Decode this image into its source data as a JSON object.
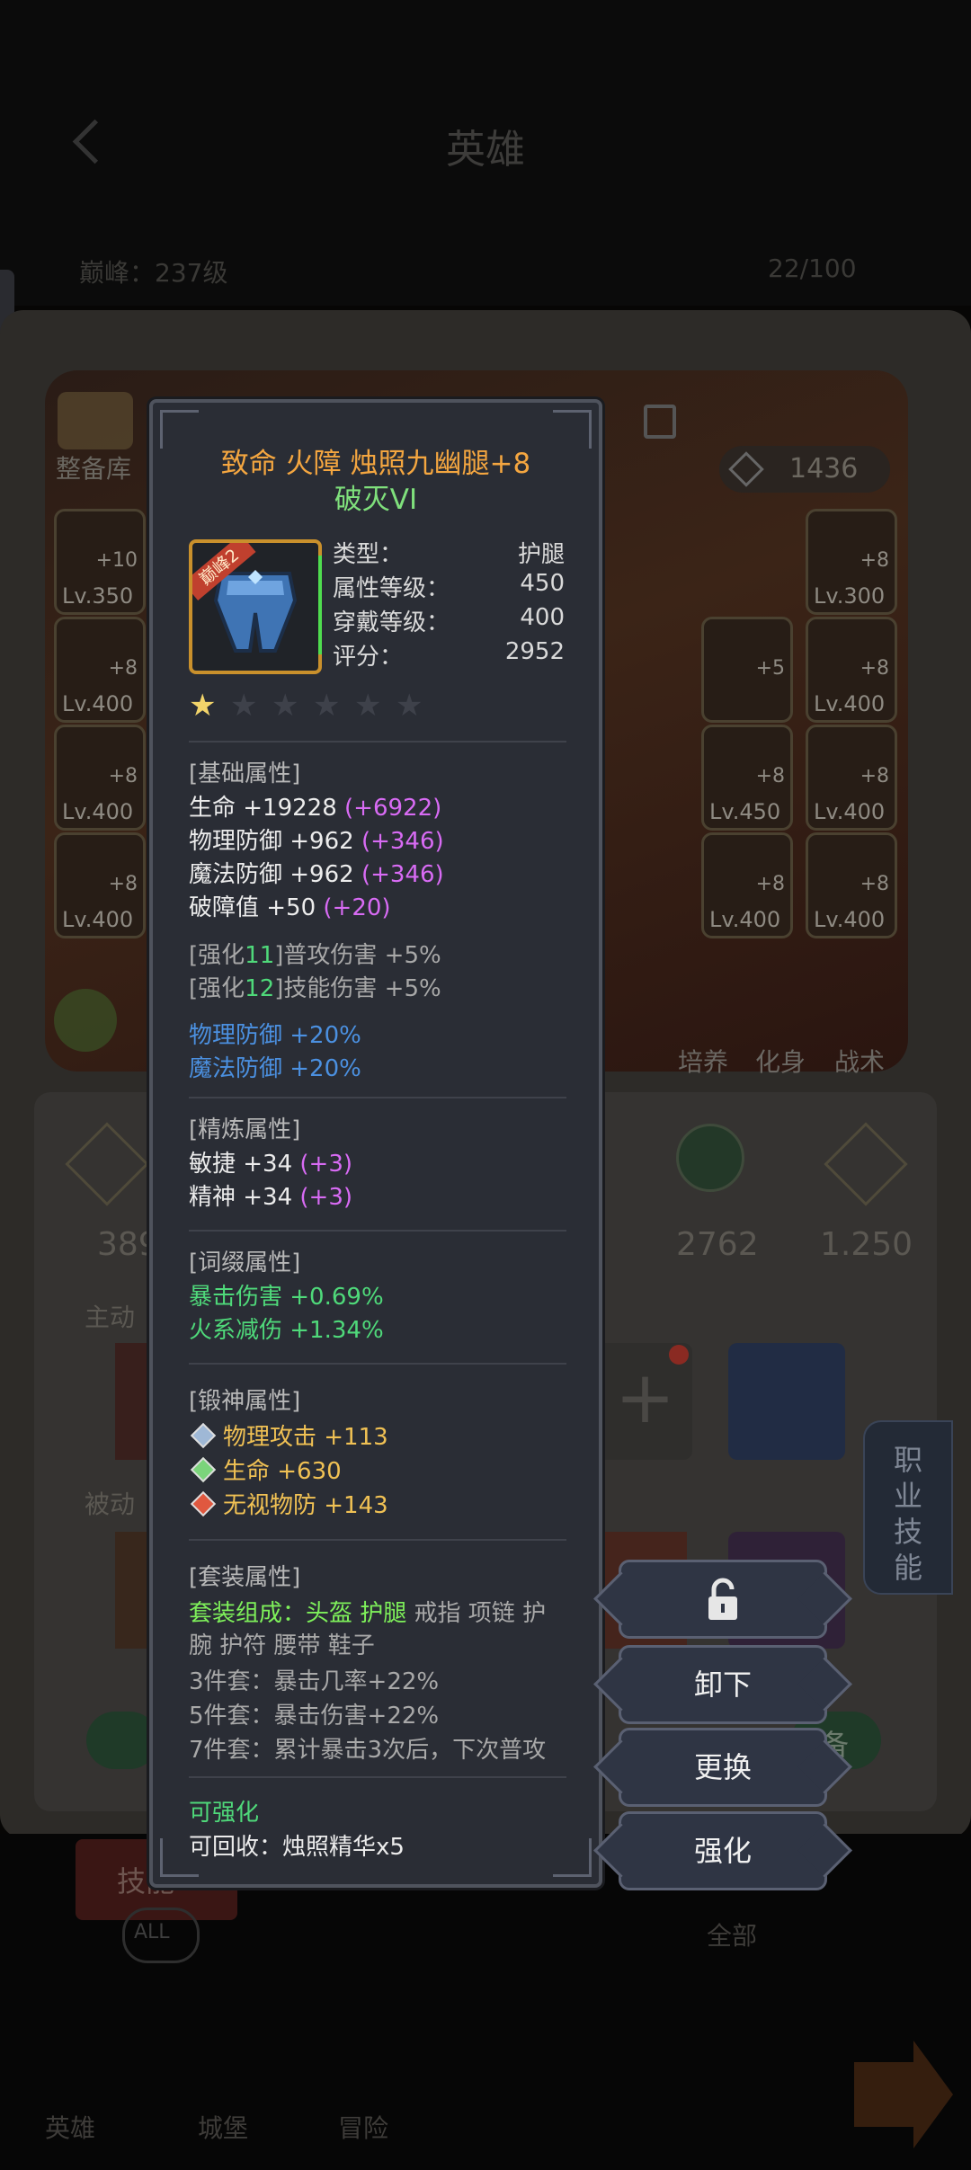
{
  "background": {
    "screen_title": "英雄",
    "peak_label": "巅峰：237级",
    "count_label": "22/100",
    "left_items": [
      {
        "level": "Lv.350",
        "plus": "+10"
      },
      {
        "level": "Lv.400",
        "plus": "+8"
      },
      {
        "level": "Lv.400",
        "plus": "+8"
      },
      {
        "level": "Lv.400",
        "plus": "+8"
      }
    ],
    "right_items": [
      {
        "level": "Lv.300",
        "plus": "+8"
      },
      {
        "level": "Lv.400",
        "plus": "+8"
      },
      {
        "level": "Lv.400",
        "plus": "+8"
      },
      {
        "level": "Lv.400",
        "plus": "+8"
      }
    ],
    "mid_items": [
      {
        "level": "",
        "plus": "+5"
      },
      {
        "level": "Lv.450",
        "plus": "+8"
      },
      {
        "level": "Lv.400",
        "plus": "+8"
      }
    ],
    "power": "1436",
    "warehouse_label": "整备库",
    "skill_icons": [
      "培养",
      "化身",
      "战术"
    ],
    "stat_left": "389",
    "stat_mid": "2762",
    "stat_right": "1.250",
    "active_label": "主动",
    "passive_label": "被动",
    "profession_tab": "职业技能",
    "bottom_tab": "技能",
    "filter_all": "全部",
    "all_badge": "ALL",
    "bottom_nav": [
      "英雄",
      "城堡",
      "冒险"
    ],
    "equip_label": "备"
  },
  "popup": {
    "title": "致命 火障 烛照九幽腿+8",
    "subtitle": "破灭VI",
    "badge": "巅峰2",
    "info": [
      {
        "key": "类型：",
        "value": "护腿"
      },
      {
        "key": "属性等级：",
        "value": "450"
      },
      {
        "key": "穿戴等级：",
        "value": "400"
      },
      {
        "key": "评分：",
        "value": "2952"
      }
    ],
    "stars_total": 6,
    "stars_filled": 1,
    "base_header": "[基础属性]",
    "base_stats": [
      {
        "text": "生命 +19228 ",
        "bonus": "(+6922)"
      },
      {
        "text": "物理防御 +962 ",
        "bonus": "(+346)"
      },
      {
        "text": "魔法防御 +962 ",
        "bonus": "(+346)"
      },
      {
        "text": "破障值 +50 ",
        "bonus": "(+20)"
      }
    ],
    "enhance_lines": [
      {
        "pre": "[强化",
        "num": "11",
        "post": "]普攻伤害 +5%"
      },
      {
        "pre": "[强化",
        "num": "12",
        "post": "]技能伤害 +5%"
      }
    ],
    "blue_lines": [
      "物理防御 +20%",
      "魔法防御 +20%"
    ],
    "refine_header": "[精炼属性]",
    "refine_stats": [
      {
        "text": "敏捷 +34 ",
        "bonus": "(+3)"
      },
      {
        "text": "精神 +34 ",
        "bonus": "(+3)"
      }
    ],
    "affix_header": "[词缀属性]",
    "affix_stats": [
      "暴击伤害 +0.69%",
      "火系减伤 +1.34%"
    ],
    "forge_header": "[锻神属性]",
    "forge_stats": [
      {
        "text": "物理攻击 +113",
        "color": "#9fb8d6"
      },
      {
        "text": "生命 +630",
        "color": "#7bd47b"
      },
      {
        "text": "无视物防 +143",
        "color": "#e0583f"
      }
    ],
    "set_header": "[套装属性]",
    "set_label": "套装组成：",
    "set_owned": "头盔 护腿",
    "set_missing_1": " 戒指 项链 护",
    "set_missing_2": "腕 护符 腰带 鞋子",
    "set_bonuses": [
      "3件套：暴击几率+22%",
      "5件套：暴击伤害+22%",
      "7件套：累计暴击3次后，下次普攻"
    ],
    "can_enhance": "可强化",
    "recycle": "可回收：烛照精华x5"
  },
  "actions": {
    "unequip": "卸下",
    "replace": "更换",
    "enhance": "强化"
  },
  "colors": {
    "title_orange": "#f4a640",
    "stat_pink": "#d86bf4",
    "affix_green": "#4fd97a",
    "effect_blue": "#4b90e0",
    "forge_gold": "#f0c154"
  }
}
